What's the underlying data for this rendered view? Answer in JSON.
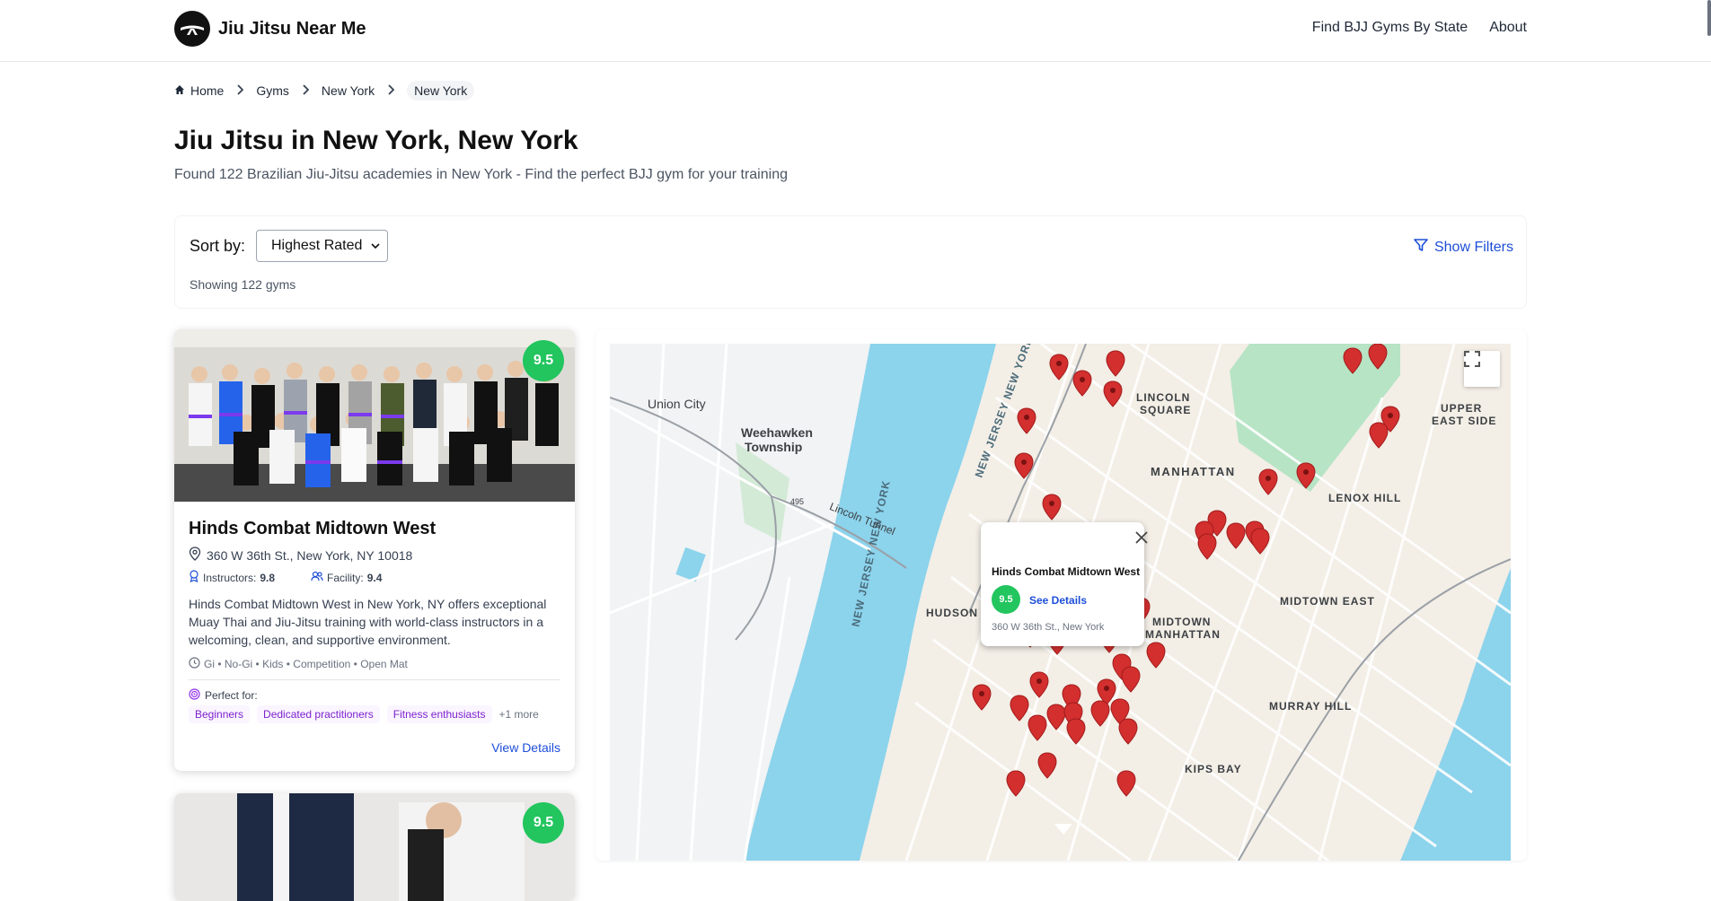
{
  "header": {
    "logo_text": "Jiu Jitsu Near Me",
    "nav": [
      "Find BJJ Gyms By State",
      "About"
    ]
  },
  "breadcrumb": [
    "Home",
    "Gyms",
    "New York",
    "New York"
  ],
  "page": {
    "title": "Jiu Jitsu in New York, New York",
    "subtitle": "Found 122 Brazilian Jiu-Jitsu academies in New York - Find the perfect BJJ gym for your training"
  },
  "sort": {
    "label": "Sort by:",
    "selected": "Highest Rated",
    "show_filters": "Show Filters",
    "showing": "Showing 122 gyms"
  },
  "gyms": [
    {
      "rating": "9.5",
      "name": "Hinds Combat Midtown West",
      "address": "360 W 36th St., New York, NY 10018",
      "instructors_label": "Instructors:",
      "instructors_score": "9.8",
      "facility_label": "Facility:",
      "facility_score": "9.4",
      "description": "Hinds Combat Midtown West in New York, NY offers exceptional Muay Thai and Jiu-Jitsu training with world-class instructors in a welcoming, clean, and supportive environment.",
      "classes": "Gi • No-Gi • Kids • Competition • Open Mat",
      "perfect_for_label": "Perfect for:",
      "perfect_for": [
        "Beginners",
        "Dedicated practitioners",
        "Fitness enthusiasts"
      ],
      "more": "+1 more",
      "view_details": "View Details"
    },
    {
      "rating": "9.5"
    }
  ],
  "map": {
    "labels": {
      "union_city": "Union City",
      "weehawken": "Weehawken Township",
      "lincoln_square": "LINCOLN SQUARE",
      "manhattan": "MANHATTAN",
      "upper_east_side": "UPPER EAST SIDE",
      "lenox_hill": "LENOX HILL",
      "hudson_yards": "HUDSON YARDS",
      "midtown_manhattan": "MIDTOWN MANHATTAN",
      "midtown_east": "MIDTOWN EAST",
      "murray_hill": "MURRAY HILL",
      "kips_bay": "KIPS BAY",
      "new_jersey_ny": "NEW JERSEY NEW YORK",
      "new_jersey_ny2": "NEW JERSEY NEW YORK",
      "lincoln_tunnel": "Lincoln Tunnel",
      "rt495": "495"
    },
    "popup": {
      "title": "Hinds Combat Midtown West",
      "rating": "9.5",
      "link": "See Details",
      "address": "360 W 36th St., New York"
    },
    "colors": {
      "water": "#8cd3ec",
      "park": "#b6e4c4",
      "pin": "#d32f2f",
      "land": "#f1f3f4"
    }
  },
  "colors": {
    "badge": "#22c55e",
    "link": "#1d4ed8",
    "chip_text": "#7e22ce",
    "chip_bg": "#faf5ff"
  }
}
